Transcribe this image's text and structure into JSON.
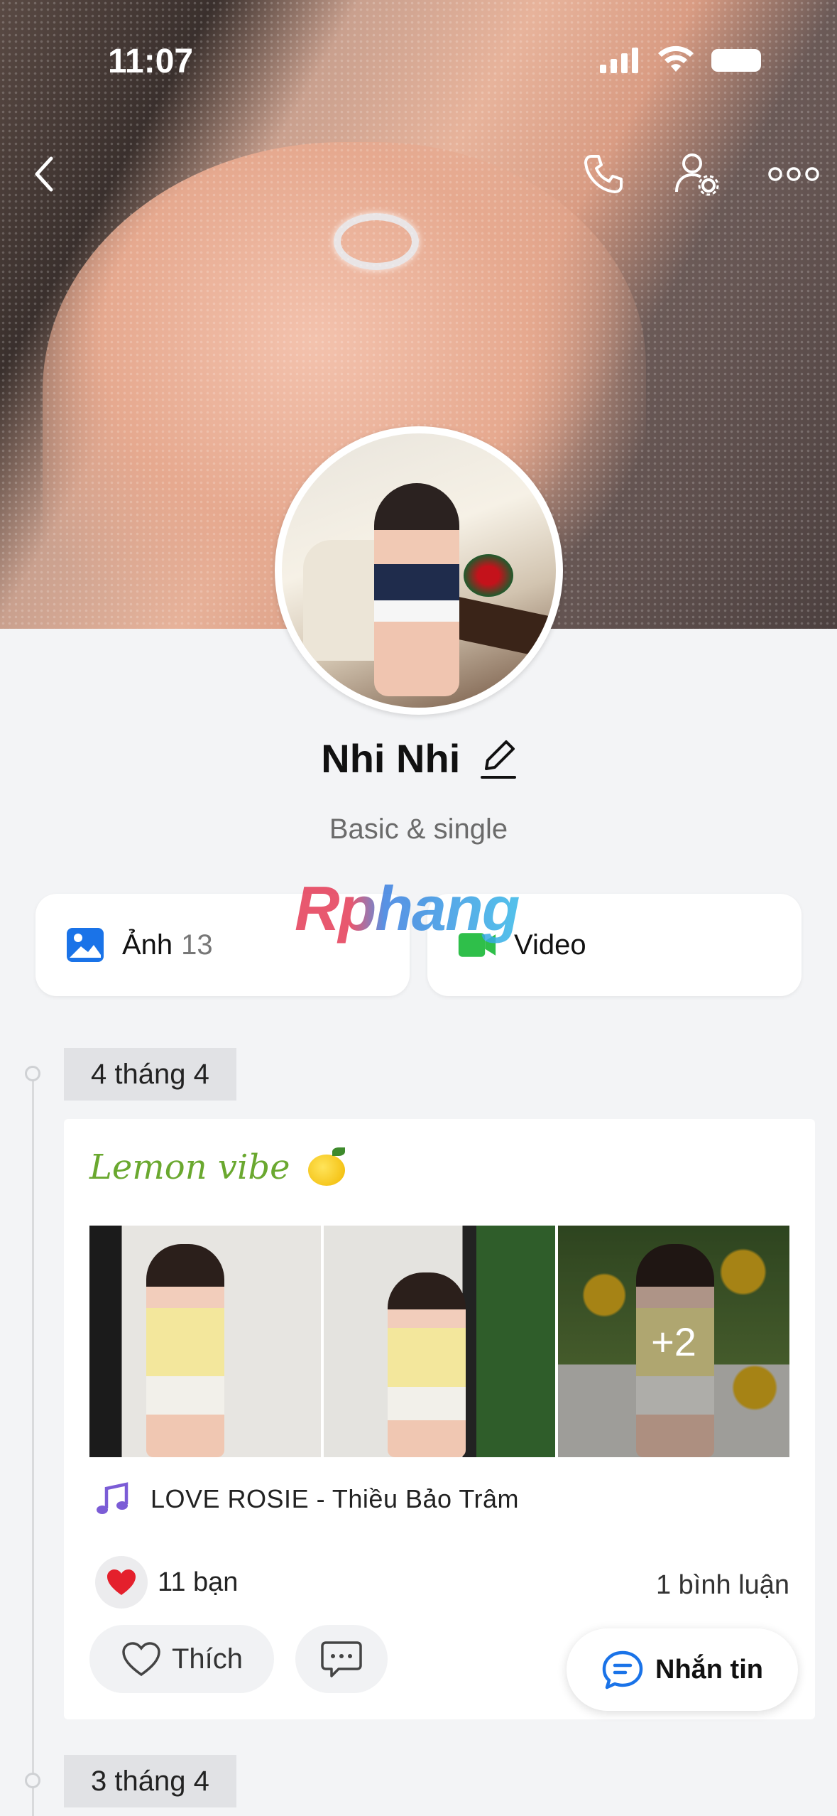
{
  "status_bar": {
    "time": "11:07"
  },
  "profile": {
    "name": "Nhi Nhi",
    "bio": "Basic & single"
  },
  "watermark": "Rphang",
  "media": {
    "photos_label": "Ảnh",
    "photos_count": "13",
    "video_label": "Video"
  },
  "timeline": [
    {
      "date": "4 tháng 4",
      "post": {
        "title": "Lemon vibe",
        "extra_photos": "+2",
        "music": "LOVE ROSIE - Thiều Bảo Trâm",
        "reactions": "11 bạn",
        "comments": "1 bình luận",
        "like_label": "Thích"
      }
    },
    {
      "date": "3 tháng 4"
    }
  ],
  "fab": {
    "label": "Nhắn tin"
  },
  "colors": {
    "accent_blue": "#1a73e8",
    "video_green": "#2fbf4a",
    "title_green": "#6aa82f",
    "music_purple": "#7b5cd6",
    "heart_red": "#e4202c"
  }
}
